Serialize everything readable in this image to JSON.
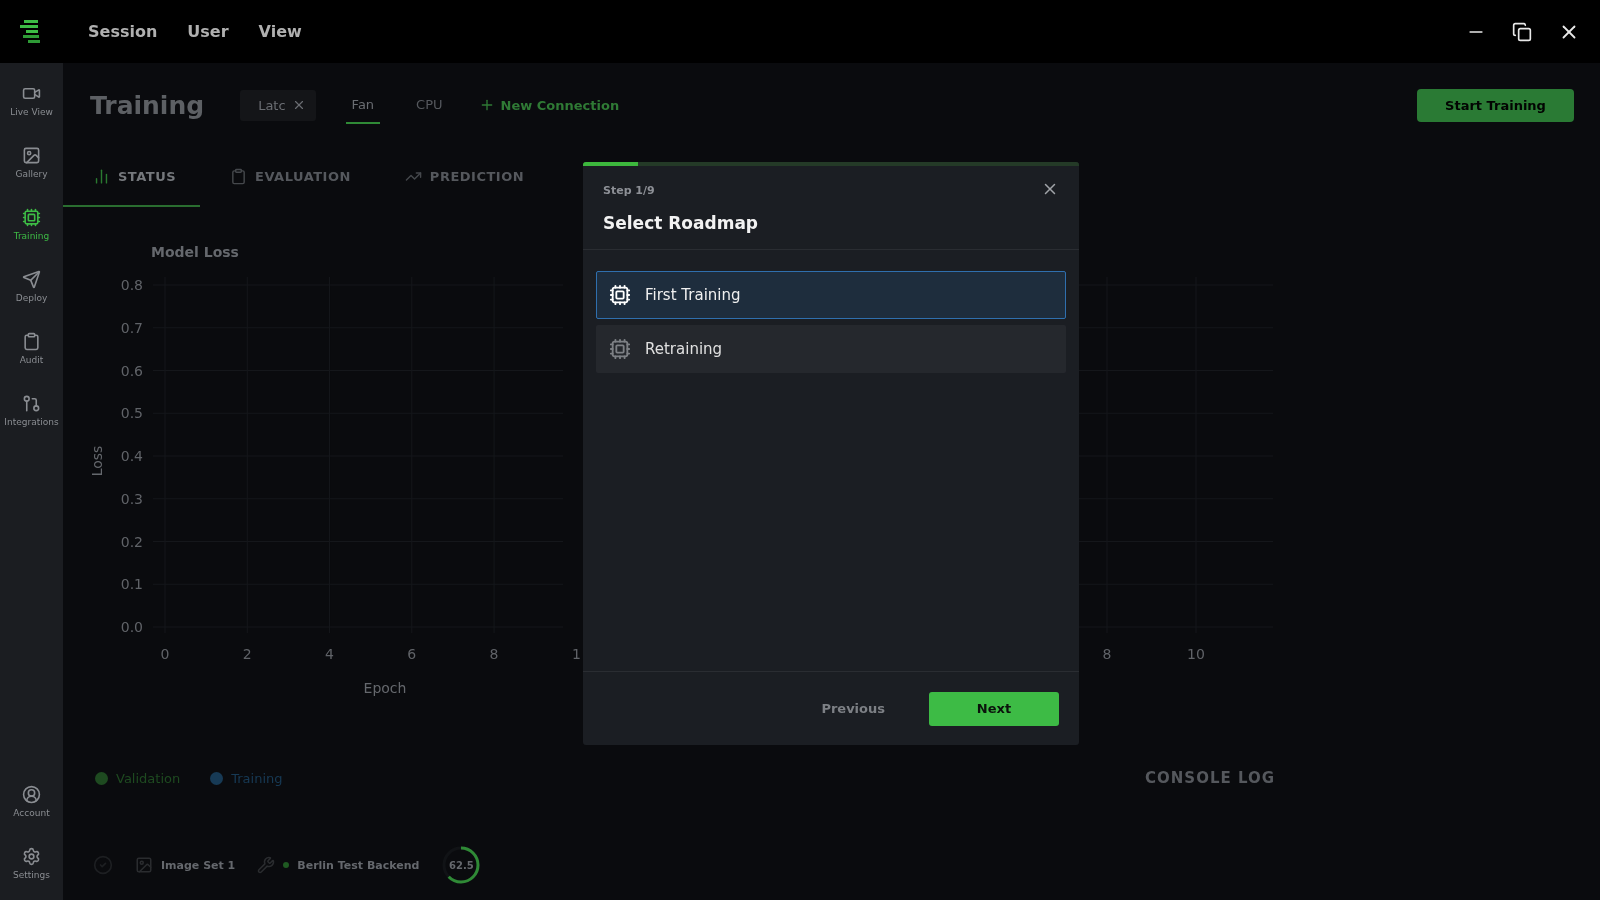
{
  "app": {
    "menu": [
      "Session",
      "User",
      "View"
    ]
  },
  "sidebar": {
    "items": [
      {
        "label": "Live View",
        "selected": false
      },
      {
        "label": "Gallery",
        "selected": false
      },
      {
        "label": "Training",
        "selected": true
      },
      {
        "label": "Deploy",
        "selected": false
      },
      {
        "label": "Audit",
        "selected": false
      },
      {
        "label": "Integrations",
        "selected": false
      }
    ],
    "bottom_items": [
      {
        "label": "Account"
      },
      {
        "label": "Settings"
      }
    ]
  },
  "page": {
    "title": "Training",
    "connections": [
      {
        "kind": "chip",
        "label": "Latc"
      },
      {
        "kind": "tab",
        "label": "Fan",
        "selected": true
      },
      {
        "kind": "tab",
        "label": "CPU",
        "selected": false
      },
      {
        "kind": "action",
        "label": "New Connection"
      }
    ],
    "primary_button": "Start Training",
    "tabs": [
      {
        "label": "STATUS",
        "selected": true
      },
      {
        "label": "EVALUATION",
        "selected": false
      },
      {
        "label": "PREDICTION",
        "selected": false
      }
    ]
  },
  "charts": [
    {
      "clipped_tick": "1",
      "chart_data": {
        "type": "line",
        "title": "Model Loss",
        "xlabel": "Epoch",
        "ylabel": "Loss",
        "grid": true,
        "xlim": [
          0,
          9.7
        ],
        "ylim": [
          0,
          0.8
        ],
        "xticks": [
          0,
          2,
          4,
          6,
          8
        ],
        "yticks": [
          {
            "value": 0,
            "label": "0.0"
          },
          {
            "value": 0.1,
            "label": "0.1"
          },
          {
            "value": 0.2,
            "label": "0.2"
          },
          {
            "value": 0.3,
            "label": "0.3"
          },
          {
            "value": 0.4,
            "label": "0.4"
          },
          {
            "value": 0.5,
            "label": "0.5"
          },
          {
            "value": 0.6,
            "label": "0.6"
          },
          {
            "value": 0.7,
            "label": "0.7"
          },
          {
            "value": 0.8,
            "label": "0.8"
          }
        ]
      }
    },
    {
      "axis_labels": [
        "8",
        "10"
      ]
    }
  ],
  "legend": [
    {
      "label": "Validation",
      "color": "#1e4a20"
    },
    {
      "label": "Training",
      "color": "#173a55"
    }
  ],
  "console_log": "CONSOLE LOG",
  "status_bar": {
    "image_set": "Image Set 1",
    "backend": "Berlin Test Backend",
    "gauge": {
      "reading": "62.5",
      "level": 0.625
    }
  },
  "dialog": {
    "step": "Step 1/9",
    "progress": {
      "level": 0.111
    },
    "title": "Select Roadmap",
    "options": [
      {
        "label": "First Training",
        "selected": true
      },
      {
        "label": "Retraining",
        "selected": false
      }
    ],
    "previous": "Previous",
    "next": "Next"
  }
}
